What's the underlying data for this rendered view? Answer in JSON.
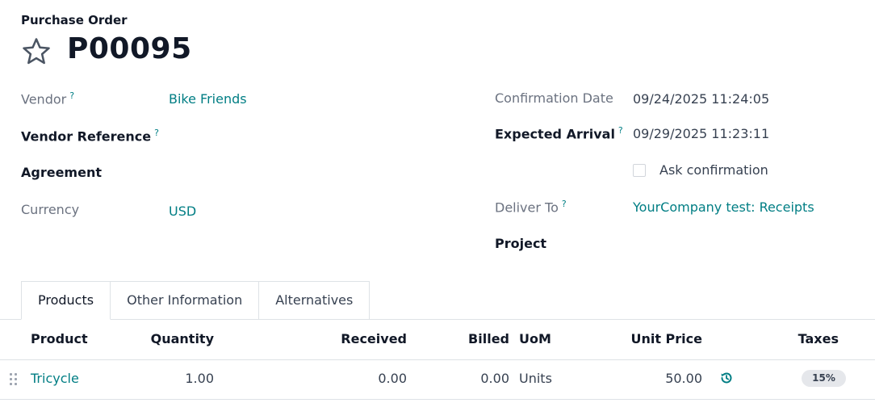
{
  "header": {
    "subtitle": "Purchase Order",
    "title": "P00095"
  },
  "left_fields": {
    "vendor_label": "Vendor",
    "vendor_value": "Bike Friends",
    "vendor_reference_label": "Vendor Reference",
    "agreement_label": "Agreement",
    "currency_label": "Currency",
    "currency_value": "USD"
  },
  "right_fields": {
    "confirmation_date_label": "Confirmation Date",
    "confirmation_date_value": "09/24/2025 11:24:05",
    "expected_arrival_label": "Expected Arrival",
    "expected_arrival_value": "09/29/2025 11:23:11",
    "ask_confirmation_label": "Ask confirmation",
    "ask_confirmation_checked": false,
    "deliver_to_label": "Deliver To",
    "deliver_to_value": "YourCompany test: Receipts",
    "project_label": "Project"
  },
  "help_marker": "?",
  "tabs": [
    {
      "label": "Products",
      "active": true
    },
    {
      "label": "Other Information",
      "active": false
    },
    {
      "label": "Alternatives",
      "active": false
    }
  ],
  "table": {
    "columns": {
      "product": "Product",
      "quantity": "Quantity",
      "received": "Received",
      "billed": "Billed",
      "uom": "UoM",
      "unit_price": "Unit Price",
      "taxes": "Taxes"
    },
    "rows": [
      {
        "product": "Tricycle",
        "quantity": "1.00",
        "received": "0.00",
        "billed": "0.00",
        "uom": "Units",
        "unit_price": "50.00",
        "taxes": "15%"
      }
    ]
  },
  "icons": {
    "star": "star-outline-icon",
    "drag_handle": "drag-handle-icon",
    "history": "history-icon"
  },
  "colors": {
    "link": "#017e84",
    "badge_bg": "#e5e7eb"
  }
}
